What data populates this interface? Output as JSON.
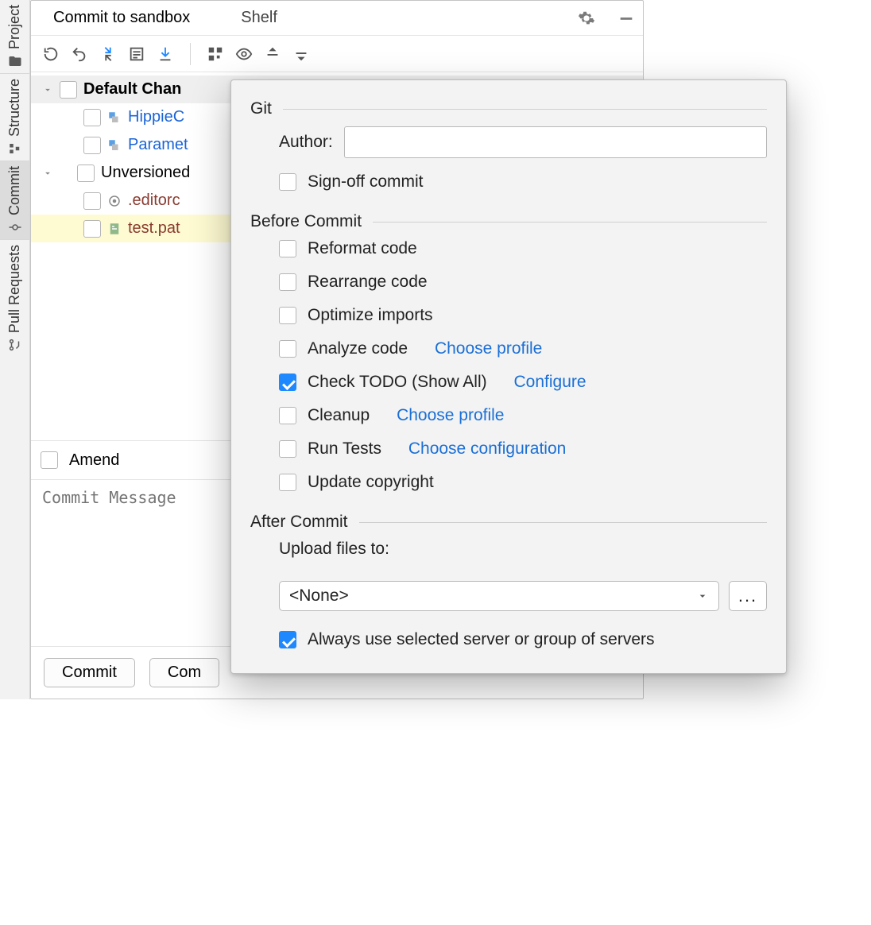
{
  "rail": {
    "project": "Project",
    "structure": "Structure",
    "commit": "Commit",
    "pull": "Pull Requests"
  },
  "tabs": {
    "commit": "Commit to sandbox",
    "shelf": "Shelf"
  },
  "tree": {
    "default_label": "Default Chan",
    "file1": "HippieC",
    "file2": "Paramet",
    "unv_label": "Unversioned ",
    "file3": ".editorc",
    "file4": "test.pat"
  },
  "amend": {
    "label": "Amend"
  },
  "msg_placeholder": "Commit Message",
  "buttons": {
    "commit": "Commit",
    "commit_and": "Com"
  },
  "popup": {
    "sections": {
      "git": "Git",
      "before": "Before Commit",
      "after": "After Commit"
    },
    "git": {
      "author_label": "Author:",
      "signoff": "Sign-off commit"
    },
    "before": {
      "reformat": "Reformat code",
      "rearrange": "Rearrange code",
      "optimize": "Optimize imports",
      "analyze": "Analyze code",
      "analyze_link": "Choose profile",
      "check_todo": "Check TODO (Show All)",
      "check_todo_link": "Configure",
      "cleanup": "Cleanup",
      "cleanup_link": "Choose profile",
      "runtests": "Run Tests",
      "runtests_link": "Choose configuration",
      "copyright": "Update copyright"
    },
    "after": {
      "upload_label": "Upload files to:",
      "upload_value": "<None>",
      "ellipsis": "...",
      "always": "Always use selected server or group of servers"
    }
  }
}
